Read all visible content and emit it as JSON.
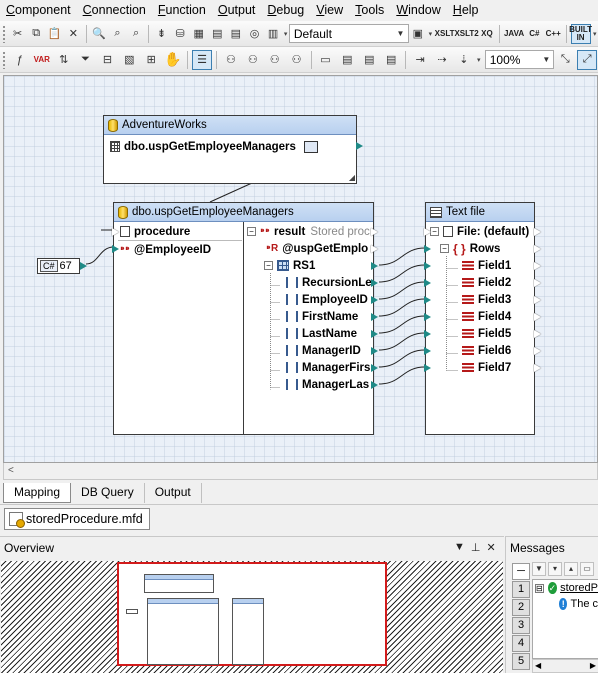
{
  "menu": [
    "Component",
    "Connection",
    "Function",
    "Output",
    "Debug",
    "View",
    "Tools",
    "Window",
    "Help"
  ],
  "toolbar1": {
    "output_combo": "Default",
    "lang_buttons": [
      "XSLT",
      "XSLT2",
      "XQ",
      "JAVA",
      "C#",
      "C++"
    ],
    "builtin_label": "BUILT IN"
  },
  "toolbar2": {
    "zoom": "100%",
    "var_label": "VAR"
  },
  "canvas": {
    "adventureworks": {
      "title": "AdventureWorks",
      "item": "dbo.uspGetEmployeeManagers"
    },
    "procedure": {
      "title": "dbo.uspGetEmployeeManagers",
      "left_header": "procedure",
      "param": "@EmployeeID",
      "result_label": "result",
      "result_note": "Stored proc",
      "result_param": "@uspGetEmplo",
      "rs": "RS1",
      "columns": [
        "RecursionLe",
        "EmployeeID",
        "FirstName",
        "LastName",
        "ManagerID",
        "ManagerFirs",
        "ManagerLas"
      ]
    },
    "constant": {
      "type": "C#",
      "value": "67"
    },
    "textfile": {
      "title": "Text file",
      "file_label": "File: (default)",
      "rows_label": "Rows",
      "fields": [
        "Field1",
        "Field2",
        "Field3",
        "Field4",
        "Field5",
        "Field6",
        "Field7"
      ]
    }
  },
  "hscroll_arrow": "<",
  "view_tabs": [
    "Mapping",
    "DB Query",
    "Output"
  ],
  "doc_tab": "storedProcedure.mfd",
  "overview": {
    "title": "Overview",
    "controls": [
      "▼",
      "⊥",
      "✕"
    ]
  },
  "messages": {
    "title": "Messages",
    "side_tabs": [
      "1",
      "2",
      "3",
      "4",
      "5"
    ],
    "rows": [
      {
        "expander": "⊟",
        "text": "storedP"
      },
      {
        "expander": "",
        "text": "The c"
      }
    ]
  },
  "colors": {
    "header_blue": "#b8d0ef",
    "connector_teal": "#1f8a87",
    "overview_red": "#d21b1b"
  }
}
